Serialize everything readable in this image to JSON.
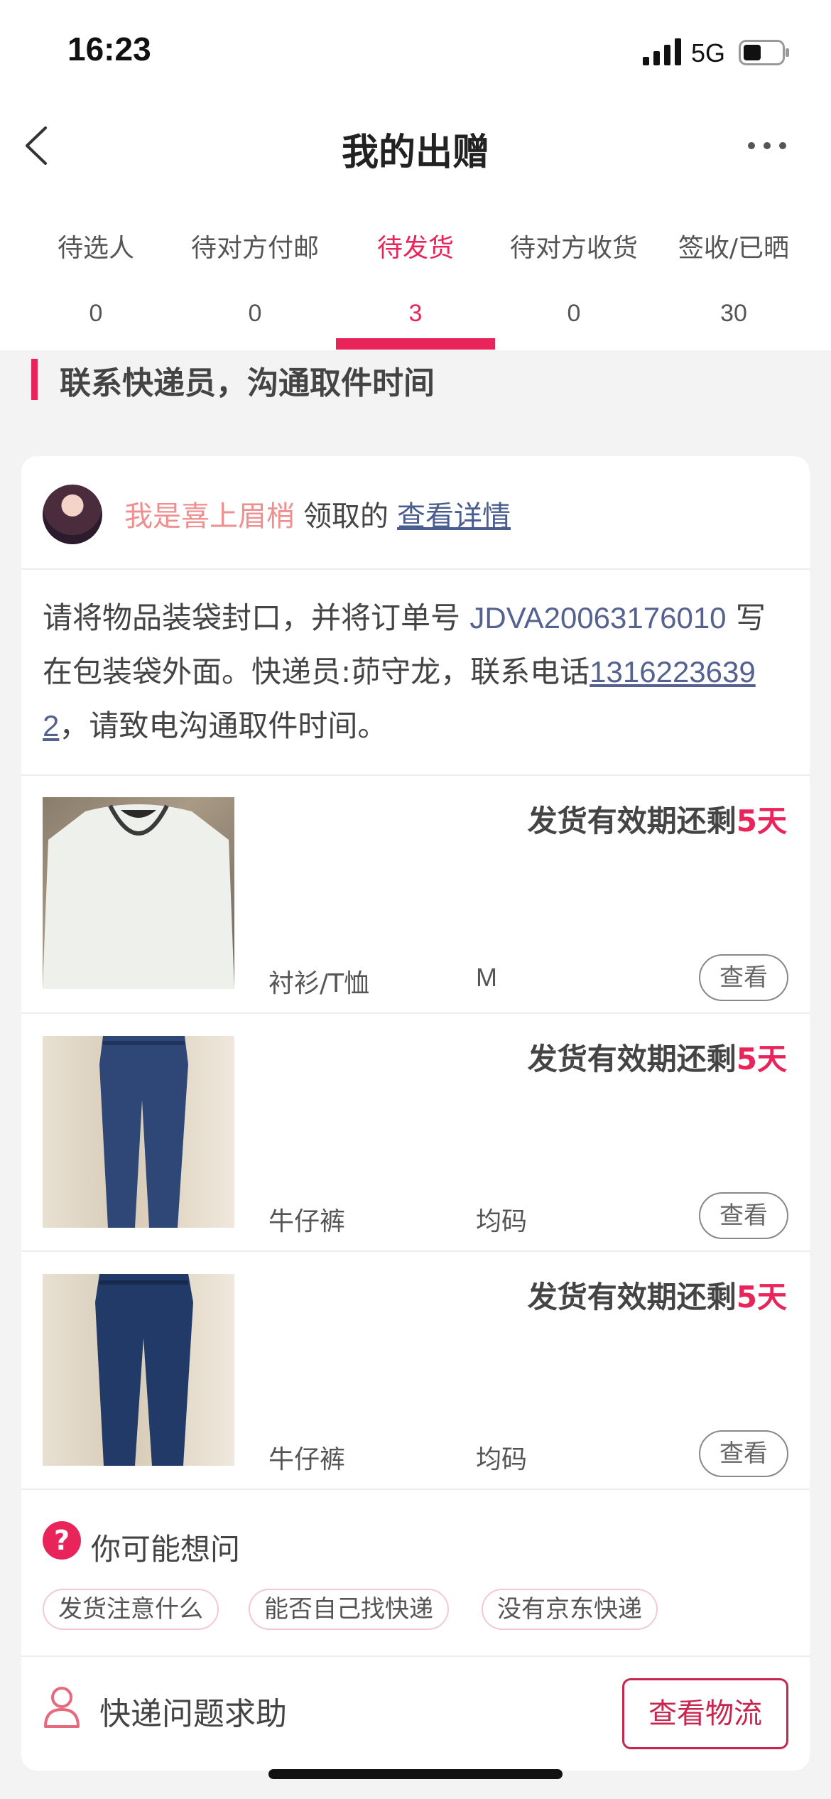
{
  "status": {
    "time": "16:23",
    "network": "5G"
  },
  "nav": {
    "title": "我的出赠"
  },
  "tabs": [
    {
      "label": "待选人",
      "count": "0"
    },
    {
      "label": "待对方付邮",
      "count": "0"
    },
    {
      "label": "待发货",
      "count": "3",
      "active": true
    },
    {
      "label": "待对方收货",
      "count": "0"
    },
    {
      "label": "签收/已晒",
      "count": "30"
    }
  ],
  "section": {
    "title": "联系快递员，沟通取件时间"
  },
  "claim": {
    "name": "我是喜上眉梢",
    "action": "领取的",
    "detail_link": "查看详情"
  },
  "notice": {
    "prefix": "请将物品装袋封口，并将订单号 ",
    "order_no": "JDVA20063176010",
    "middle": " 写在包装袋外面。快递员:茆守龙，联系电话",
    "phone": "13162236392",
    "suffix": "，请致电沟通取件时间。"
  },
  "items": [
    {
      "deadline_prefix": "发货有效期还剩",
      "deadline_days": "5天",
      "category": "衬衫/T恤",
      "size": "M",
      "view_label": "查看"
    },
    {
      "deadline_prefix": "发货有效期还剩",
      "deadline_days": "5天",
      "category": "牛仔裤",
      "size": "均码",
      "view_label": "查看"
    },
    {
      "deadline_prefix": "发货有效期还剩",
      "deadline_days": "5天",
      "category": "牛仔裤",
      "size": "均码",
      "view_label": "查看"
    }
  ],
  "faq": {
    "icon": "?",
    "title": "你可能想问",
    "chips": [
      "发货注意什么",
      "能否自己找快递",
      "没有京东快递"
    ]
  },
  "bottom": {
    "help_label": "快递问题求助",
    "logistics_button": "查看物流"
  },
  "colors": {
    "accent": "#e8245a",
    "link": "#4a5d8f",
    "name": "#ef8f8f"
  }
}
